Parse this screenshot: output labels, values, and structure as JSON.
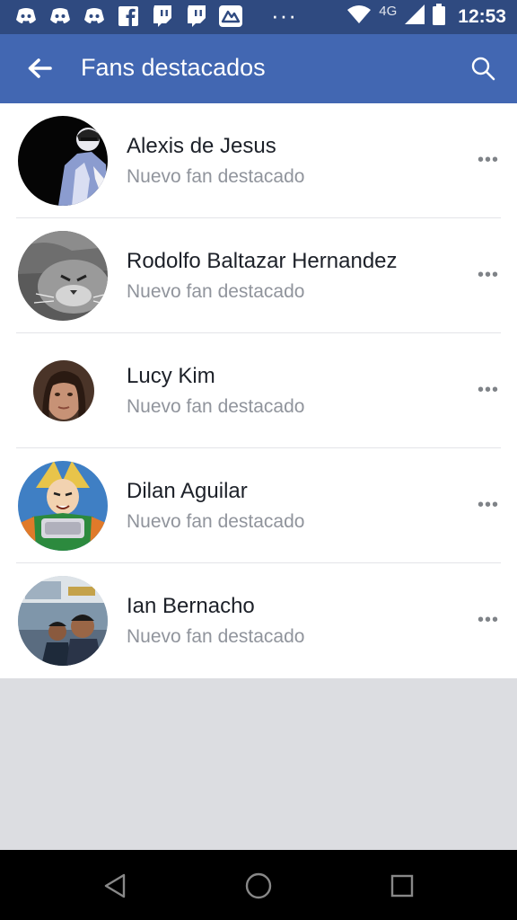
{
  "status_bar": {
    "time": "12:53",
    "network": "4G",
    "overflow": "···",
    "notification_icons": [
      "discord-icon",
      "discord-icon",
      "discord-icon",
      "facebook-icon",
      "twitch-icon",
      "twitch-icon",
      "app-icon"
    ]
  },
  "header": {
    "title": "Fans destacados",
    "back_icon": "back-arrow-icon",
    "search_icon": "search-icon"
  },
  "fans": [
    {
      "name": "Alexis de Jesus",
      "subtitle": "Nuevo fan destacado"
    },
    {
      "name": "Rodolfo Baltazar Hernandez",
      "subtitle": "Nuevo fan destacado"
    },
    {
      "name": "Lucy Kim",
      "subtitle": "Nuevo fan destacado"
    },
    {
      "name": "Dilan Aguilar",
      "subtitle": "Nuevo fan destacado"
    },
    {
      "name": "Ian Bernacho",
      "subtitle": "Nuevo fan destacado"
    }
  ],
  "more_label": "•••",
  "colors": {
    "status_bar": "#2f4a80",
    "app_bar": "#4267b2",
    "list_bg": "#ffffff",
    "page_bg": "#dcdde1",
    "name_text": "#1d2129",
    "subtitle_text": "#90949c"
  }
}
